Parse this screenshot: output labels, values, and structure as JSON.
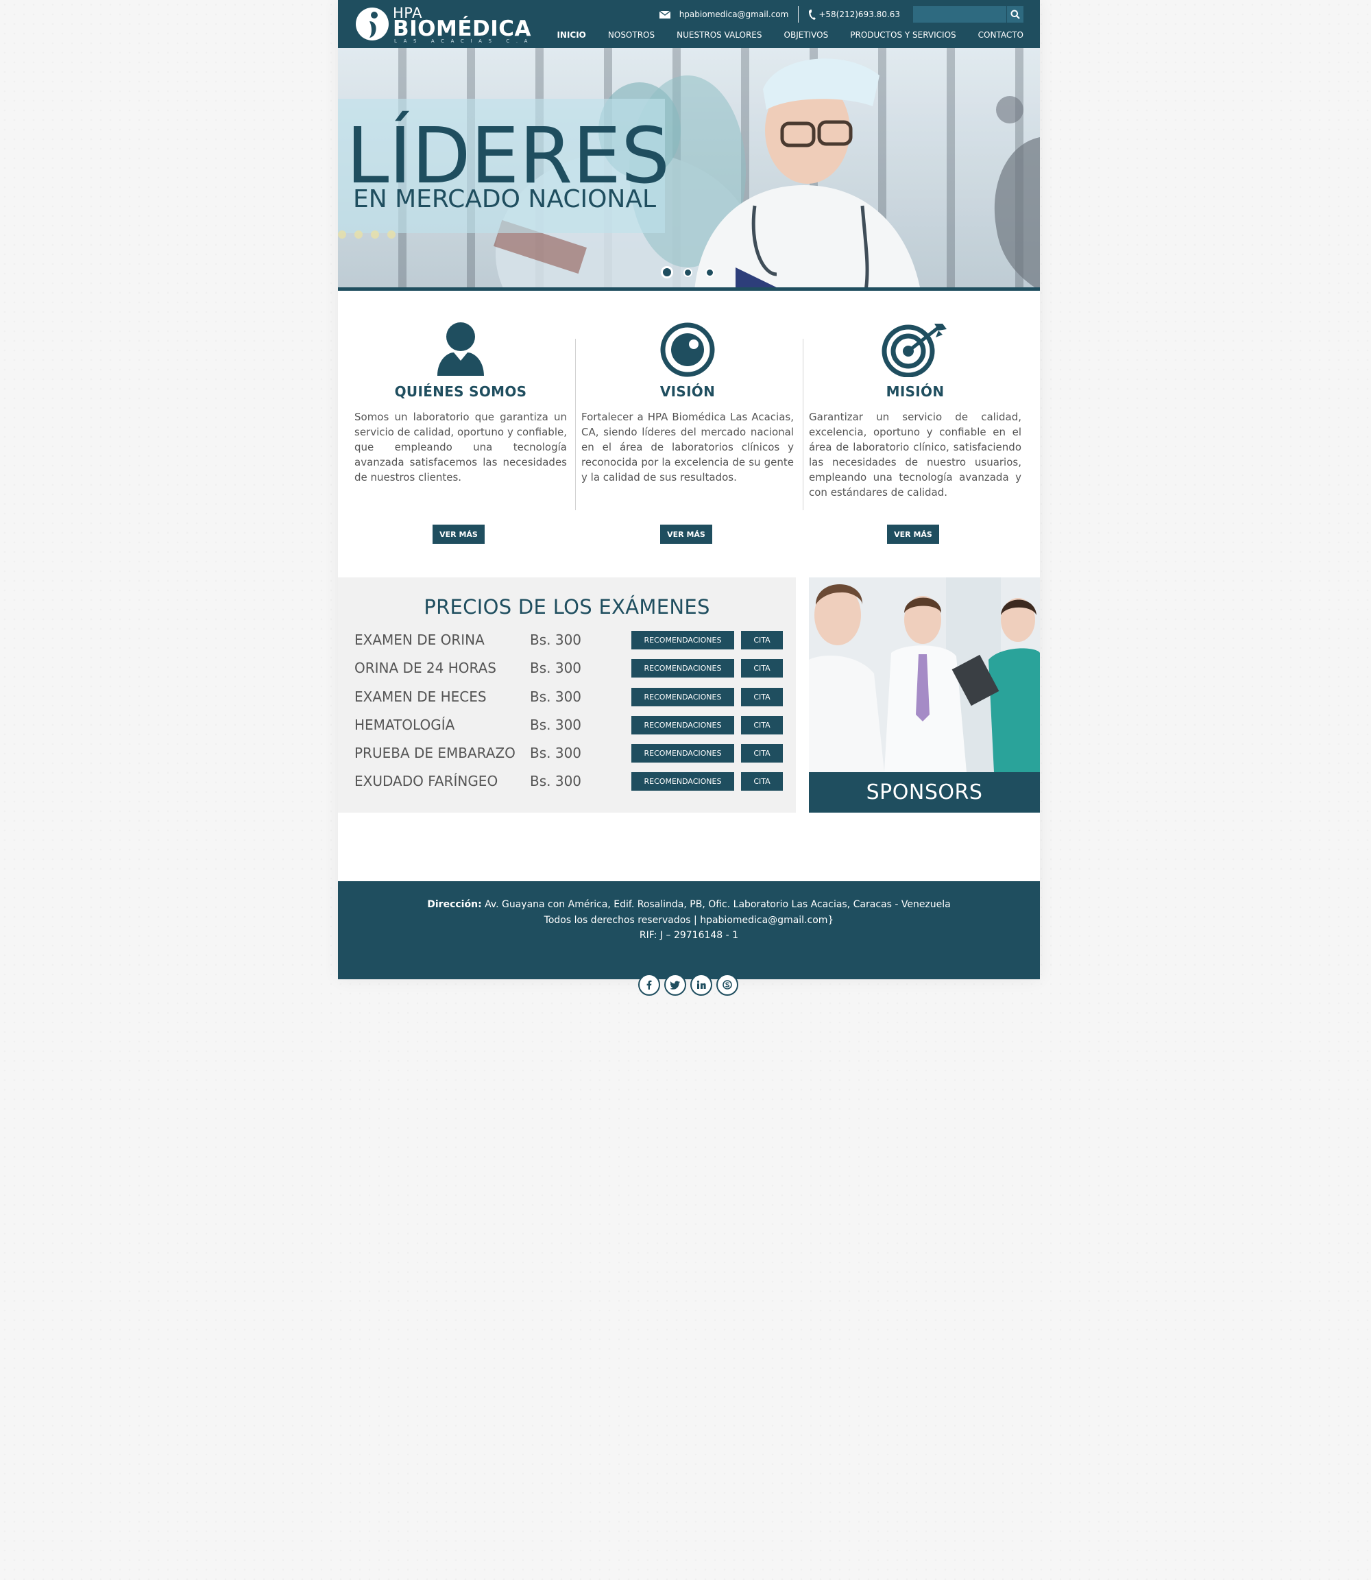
{
  "colors": {
    "primary": "#1f4e5f",
    "panel": "#f1f1f1",
    "text": "#555555"
  },
  "brand": {
    "hpa": "HPA",
    "name": "BIOMÉDICA",
    "subtitle": "LAS ACACIAS C.A"
  },
  "contact": {
    "email": "hpabiomedica@gmail.com",
    "phone": "+58(212)693.80.63"
  },
  "search": {
    "placeholder": "",
    "icon": "search-icon"
  },
  "nav": [
    {
      "label": "INICIO",
      "active": true
    },
    {
      "label": "NOSOTROS"
    },
    {
      "label": "NUESTROS VALORES"
    },
    {
      "label": "OBJETIVOS"
    },
    {
      "label": "PRODUCTOS Y SERVICIOS"
    },
    {
      "label": "CONTACTO"
    }
  ],
  "hero": {
    "title": "LÍDERES",
    "subtitle": "EN MERCADO NACIONAL",
    "slide_count": 3,
    "active_slide": 1
  },
  "features": [
    {
      "icon": "person-icon",
      "title": "QUIÉNES SOMOS",
      "text": "Somos un laboratorio que garantiza un servicio de calidad, oportuno y confiable, que empleando una tecnología avanzada satisfacemos las necesidades de nuestros clientes.",
      "button": "VER MÁS"
    },
    {
      "icon": "eye-icon",
      "title": "VISIÓN",
      "text": "Fortalecer a HPA Biomédica Las Acacias, CA, siendo líderes del mercado nacional en el área de laboratorios clínicos y reconocida por la excelencia de su gente y la calidad de sus resultados.",
      "button": "VER MÁS"
    },
    {
      "icon": "target-icon",
      "title": "MISIÓN",
      "text": "Garantizar un servicio de calidad, excelencia, oportuno y confiable en el área de laboratorio clínico, satisfaciendo las necesidades de nuestro usuarios, empleando una tecnología avanzada y con estándares de calidad.",
      "button": "VER MÁS"
    }
  ],
  "prices": {
    "title": "PRECIOS DE LOS EXÁMENES",
    "recommend_label": "RECOMENDACIONES",
    "cita_label": "CITA",
    "rows": [
      {
        "name": "EXAMEN DE ORINA",
        "price": "Bs. 300"
      },
      {
        "name": "ORINA DE 24 HORAS",
        "price": "Bs. 300"
      },
      {
        "name": "EXAMEN DE HECES",
        "price": "Bs. 300"
      },
      {
        "name": "HEMATOLOGÍA",
        "price": "Bs. 300"
      },
      {
        "name": "PRUEBA DE EMBARAZO",
        "price": "Bs. 300"
      },
      {
        "name": "EXUDADO FARÍNGEO",
        "price": "Bs. 300"
      }
    ]
  },
  "sponsors": {
    "label": "SPONSORS"
  },
  "footer": {
    "address_label": "Dirección:",
    "address": " Av. Guayana con América, Edif. Rosalinda, PB, Ofic. Laboratorio Las Acacias, Caracas - Venezuela",
    "rights": "Todos los derechos reservados | hpabiomedica@gmail.com}",
    "rif": "RIF: J – 29716148 - 1"
  },
  "social": [
    "facebook-icon",
    "twitter-icon",
    "linkedin-icon",
    "skype-icon"
  ]
}
